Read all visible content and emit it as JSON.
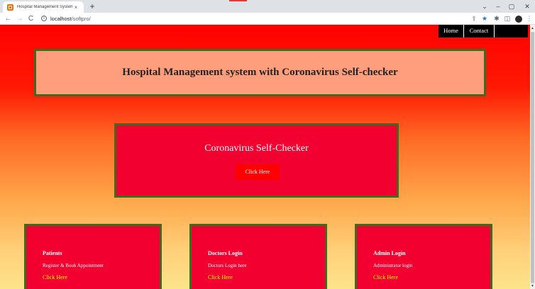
{
  "browser": {
    "tab_title": "Hospital Management System",
    "tab_close": "×",
    "new_tab": "+",
    "accent_color": "#e53935",
    "window_controls": [
      "⌄",
      "–",
      "▢",
      "✕"
    ],
    "nav": {
      "back": "←",
      "forward": "→",
      "reload": "C",
      "info": "i"
    },
    "url_host": "localhost",
    "url_path": "/softpro/",
    "toolbar_icons": [
      "share-icon",
      "star-icon",
      "extensions-icon",
      "sidepanel-icon",
      "profile-icon",
      "menu-icon"
    ],
    "toolbar_glyphs": {
      "share": "⇪",
      "star": "★",
      "extensions": "✱",
      "sidepanel": "◫",
      "menu": "⋮"
    }
  },
  "page": {
    "nav": {
      "home": "Home",
      "contact": "Contact"
    },
    "header_title": "Hospital Management system with Coronavirus Self-checker",
    "checker": {
      "title": "Coronavirus Self-Checker",
      "button": "Click Here"
    },
    "cards": [
      {
        "title": "Patients",
        "desc": "Register & Book Appointment",
        "link": "Click Here"
      },
      {
        "title": "Doctors Login",
        "desc": "Doctors Login here",
        "link": "Click Here"
      },
      {
        "title": "Admin Login",
        "desc": "Administrator login",
        "link": "Click Here"
      }
    ],
    "colors": {
      "card_bg": "#f20030",
      "border": "#3d6b1f",
      "header_bg": "#ff9e7c",
      "link": "#ffff00",
      "button_bg": "#ff0000"
    }
  }
}
